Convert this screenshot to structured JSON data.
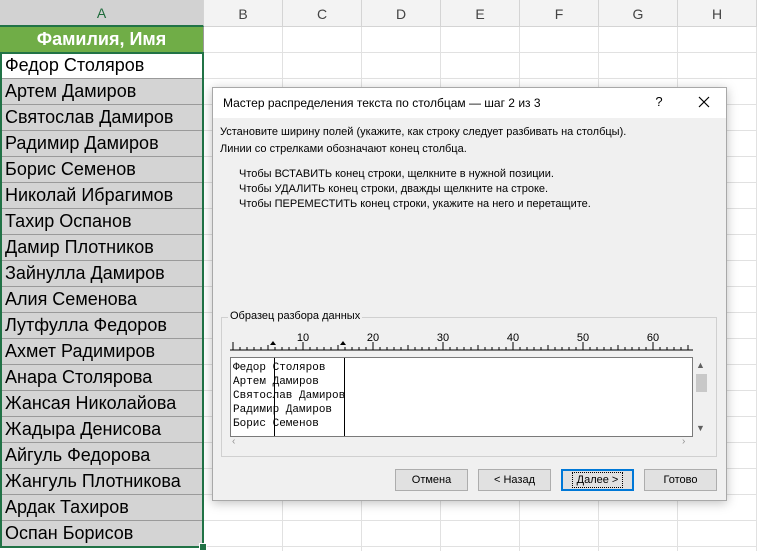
{
  "columns": [
    "A",
    "B",
    "C",
    "D",
    "E",
    "F",
    "G",
    "H"
  ],
  "column_a": {
    "header": "Фамилия,  Имя",
    "rows": [
      "Федор Столяров",
      "Артем Дамиров",
      "Святослав Дамиров",
      "Радимир Дамиров",
      "Борис Семенов",
      "Николай Ибрагимов",
      "Тахир Оспанов",
      "Дамир Плотников",
      "Зайнулла Дамиров",
      "Алия Семенова",
      "Лутфулла Федоров",
      "Ахмет Радимиров",
      "Анара Столярова",
      "Жансая Николайова",
      "Жадыра Денисова",
      "Айгуль Федорова",
      "Жангуль Плотникова",
      "Ардак Тахиров",
      "Оспан Борисов"
    ]
  },
  "dialog": {
    "title": "Мастер распределения текста по столбцам — шаг 2 из 3",
    "help_label": "?",
    "instructions": [
      "Установите ширину полей (укажите, как строку следует разбивать на столбцы).",
      "Линии со стрелками обозначают конец столбца."
    ],
    "bullets": [
      "Чтобы ВСТАВИТЬ конец строки, щелкните в нужной позиции.",
      "Чтобы УДАЛИТЬ конец строки, дважды щелкните на строке.",
      "Чтобы ПЕРЕМЕСТИТЬ конец строки, укажите на него и перетащите."
    ],
    "preview_label": "Образец разбора данных",
    "ruler_labels": [
      "10",
      "20",
      "30",
      "40",
      "50",
      "60"
    ],
    "preview_lines": [
      "Федор Столяров",
      "Артем Дамиров",
      "Святослав Дамиров",
      "Радимир Дамиров",
      "Борис Семенов"
    ],
    "buttons": {
      "cancel": "Отмена",
      "back": "< Назад",
      "next": "Далее >",
      "finish": "Готово"
    }
  },
  "colors": {
    "header_fill": "#70ad47",
    "cell_fill": "#d4d4d4",
    "selection": "#217346"
  }
}
